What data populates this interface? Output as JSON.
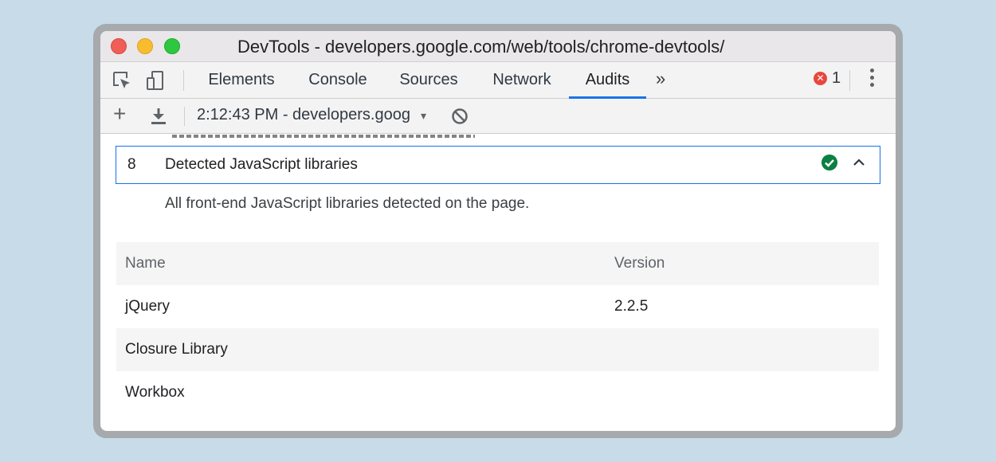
{
  "window": {
    "title": "DevTools - developers.google.com/web/tools/chrome-devtools/"
  },
  "tabs": [
    {
      "label": "Elements",
      "active": false
    },
    {
      "label": "Console",
      "active": false
    },
    {
      "label": "Sources",
      "active": false
    },
    {
      "label": "Network",
      "active": false
    },
    {
      "label": "Audits",
      "active": true
    }
  ],
  "tabbar": {
    "more_tabs": "»",
    "error_count": "1",
    "icons": [
      "inspect-element-icon",
      "device-toolbar-icon",
      "error-icon",
      "more-options-icon"
    ]
  },
  "audit_toolbar": {
    "plus": "+",
    "report": "2:12:43 PM - developers.goog",
    "report_caret": "▾",
    "icons": [
      "add-icon",
      "download-icon",
      "dropdown-caret-icon",
      "clear-block-icon"
    ]
  },
  "audit": {
    "index": "8",
    "title": "Detected JavaScript libraries",
    "status": "pass",
    "description": "All front-end JavaScript libraries detected on the page."
  },
  "library_table": {
    "columns": [
      "Name",
      "Version"
    ],
    "rows": [
      {
        "name": "jQuery",
        "version": "2.2.5"
      },
      {
        "name": "Closure Library",
        "version": ""
      },
      {
        "name": "Workbox",
        "version": ""
      }
    ]
  },
  "colors": {
    "background": "#c7dbe9",
    "accent": "#1a73e8",
    "pass": "#0b8043",
    "error": "#e8473c"
  }
}
